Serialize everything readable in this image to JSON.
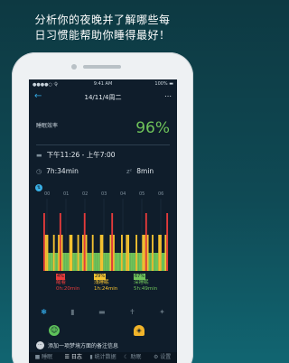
{
  "caption": {
    "line1": "分析你的夜晚并了解哪些每",
    "line2": "日习惯能帮助你睡得最好！"
  },
  "statusbar": {
    "carrier": "●●●●○ 令",
    "time": "9:41 AM",
    "battery": "100% ▬"
  },
  "header": {
    "back_icon": "arrow-left-icon",
    "date": "14/11/4周二",
    "right_icon": "share-icon"
  },
  "efficiency": {
    "label": "睡眠效率",
    "value": "96%"
  },
  "bedtime": {
    "range": "下午11:26 - 上午7:00"
  },
  "asleep": {
    "duration": "7h:34min"
  },
  "time_to_sleep": {
    "value": "8min"
  },
  "legend": {
    "awake": {
      "pct": "4%",
      "label": "醒着",
      "duration": "0h:20min"
    },
    "light": {
      "pct": "29%",
      "label": "浅睡眠",
      "duration": "1h:24min"
    },
    "deep": {
      "pct": "67%",
      "label": "深睡眠",
      "duration": "5h:49min"
    }
  },
  "note": {
    "text": "添加一项梦境方面的备注信息"
  },
  "tabs": [
    {
      "label": "■ 睡眠"
    },
    {
      "label": "☰ 日志"
    },
    {
      "label": "▮ 统计数据"
    },
    {
      "label": "☾ 助眠"
    },
    {
      "label": "⚙ 设置"
    }
  ],
  "colors": {
    "awake": "#e63b3b",
    "light": "#f5c231",
    "deep": "#6fc35a",
    "accent": "#34a6e0"
  }
}
